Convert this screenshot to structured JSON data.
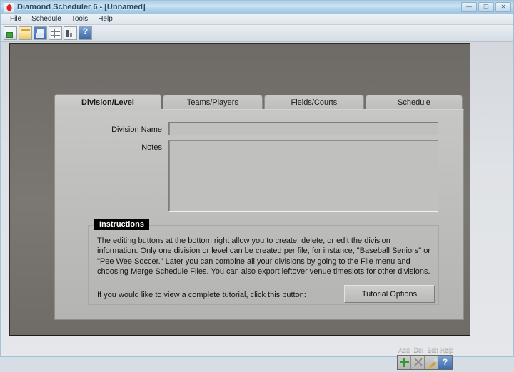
{
  "window": {
    "title": "Diamond Scheduler 6 - [Unnamed]",
    "icon": "diamond-app-icon",
    "controls": {
      "minimize": "—",
      "maximize": "❐",
      "close": "✕"
    }
  },
  "menu": {
    "items": [
      {
        "label": "File"
      },
      {
        "label": "Schedule"
      },
      {
        "label": "Tools"
      },
      {
        "label": "Help"
      }
    ]
  },
  "toolbar": {
    "buttons": [
      {
        "name": "new-file-icon"
      },
      {
        "name": "open-folder-icon"
      },
      {
        "name": "save-icon"
      },
      {
        "name": "grid-table-icon"
      },
      {
        "name": "chart-icon"
      },
      {
        "name": "help-icon"
      }
    ]
  },
  "tabs": [
    {
      "label": "Division/Level",
      "active": true
    },
    {
      "label": "Teams/Players",
      "active": false
    },
    {
      "label": "Fields/Courts",
      "active": false
    },
    {
      "label": "Schedule",
      "active": false
    }
  ],
  "form": {
    "division_name_label": "Division Name",
    "division_name_value": "",
    "notes_label": "Notes",
    "notes_value": ""
  },
  "instructions": {
    "legend": "Instructions",
    "body": "The editing buttons at the bottom right allow you to create, delete, or edit the division information. Only one division or level can be created per file, for instance, \"Baseball Seniors\" or \"Pee Wee Soccer.\"  Later you can combine all your divisions by going to the File menu and choosing Merge Schedule Files. You can also export leftover venue timeslots for other divisions.",
    "tutorial_line": "If you would like to view a complete tutorial, click this button:",
    "tutorial_button": "Tutorial Options"
  },
  "edit_cluster": {
    "labels": [
      "Add",
      "Del",
      "Edit",
      "Help"
    ],
    "icons": [
      "plus-icon",
      "delete-x-icon",
      "pencil-icon",
      "question-mark-icon"
    ]
  },
  "colors": {
    "title_bar": "#aecfe8",
    "child_window": "#7b7872",
    "tab_page": "#bcbcba",
    "legend_bg": "#000000",
    "add_green": "#2e9b2e",
    "help_blue": "#3f6aa8"
  }
}
